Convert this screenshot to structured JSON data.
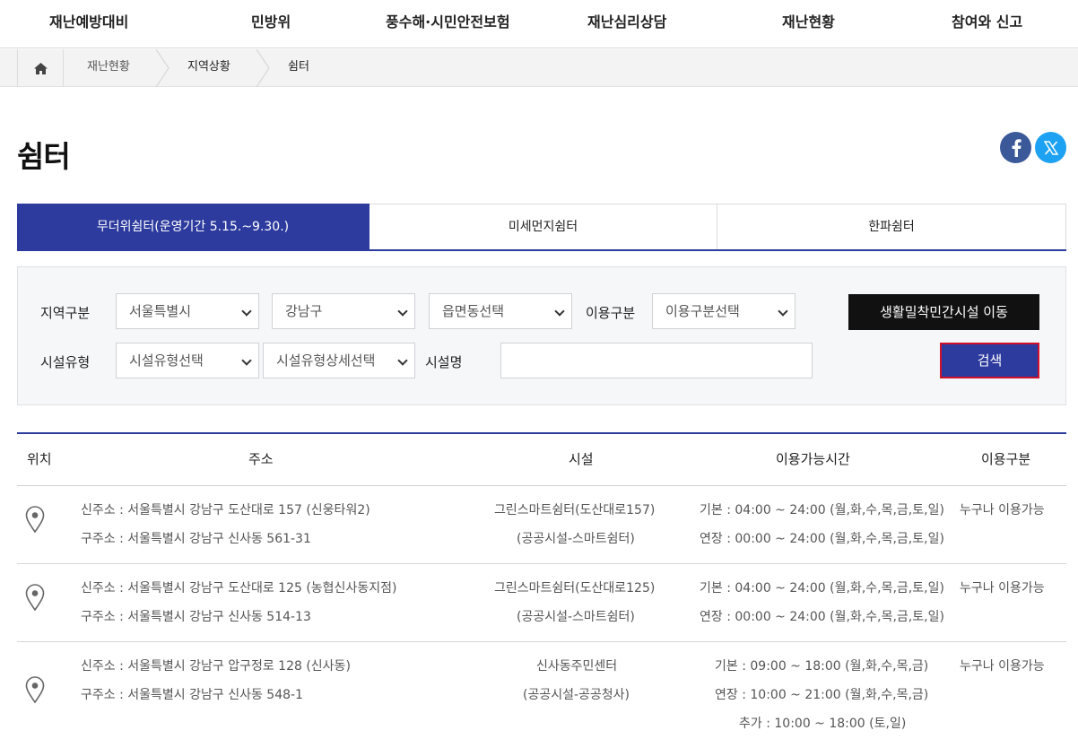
{
  "nav": [
    "재난예방대비",
    "민방위",
    "풍수해·시민안전보험",
    "재난심리상담",
    "재난현황",
    "참여와 신고"
  ],
  "breadcrumb": {
    "home_icon": "home-icon",
    "items": [
      "재난현황",
      "지역상황",
      "쉼터"
    ]
  },
  "page_title": "쉼터",
  "share": {
    "facebook_icon": "facebook-icon",
    "x_icon": "x-icon"
  },
  "tabs": [
    {
      "label": "무더위쉼터(운영기간 5.15.~9.30.)",
      "active": true
    },
    {
      "label": "미세먼지쉼터",
      "active": false
    },
    {
      "label": "한파쉼터",
      "active": false
    }
  ],
  "search": {
    "region_label": "지역구분",
    "sido": "서울특별시",
    "sigungu": "강남구",
    "dong": "읍면동선택",
    "usage_label": "이용구분",
    "usage": "이용구분선택",
    "private_facility_button": "생활밀착민간시설 이동",
    "facility_type_label": "시설유형",
    "facility_type": "시설유형선택",
    "facility_type_detail": "시설유형상세선택",
    "facility_name_label": "시설명",
    "facility_name_value": "",
    "search_button": "검색"
  },
  "table": {
    "headers": [
      "위치",
      "주소",
      "시설",
      "이용가능시간",
      "이용구분"
    ],
    "rows": [
      {
        "new_address": "신주소 : 서울특별시 강남구 도산대로 157 (신웅타워2)",
        "old_address": "구주소 : 서울특별시 강남구 신사동 561-31",
        "facility_name": "그린스마트쉼터(도산대로157)",
        "facility_type": "(공공시설-스마트쉼터)",
        "hours": [
          "기본 : 04:00 ~ 24:00 (월,화,수,목,금,토,일)",
          "연장 : 00:00 ~ 24:00 (월,화,수,목,금,토,일)"
        ],
        "usage": "누구나 이용가능"
      },
      {
        "new_address": "신주소 : 서울특별시 강남구 도산대로 125 (농협신사동지점)",
        "old_address": "구주소 : 서울특별시 강남구 신사동 514-13",
        "facility_name": "그린스마트쉼터(도산대로125)",
        "facility_type": "(공공시설-스마트쉼터)",
        "hours": [
          "기본 : 04:00 ~ 24:00 (월,화,수,목,금,토,일)",
          "연장 : 00:00 ~ 24:00 (월,화,수,목,금,토,일)"
        ],
        "usage": "누구나 이용가능"
      },
      {
        "new_address": "신주소 : 서울특별시 강남구 압구정로 128 (신사동)",
        "old_address": "구주소 : 서울특별시 강남구 신사동 548-1",
        "facility_name": "신사동주민센터",
        "facility_type": "(공공시설-공공청사)",
        "hours": [
          "기본 : 09:00 ~ 18:00 (월,화,수,목,금)",
          "연장 : 10:00 ~ 21:00 (월,화,수,목,금)",
          "추가 : 10:00 ~ 18:00 (토,일)"
        ],
        "usage": "누구나 이용가능"
      }
    ]
  },
  "colors": {
    "primary": "#2d3b9e",
    "search_border": "#d0112b",
    "dark_button": "#111111"
  }
}
